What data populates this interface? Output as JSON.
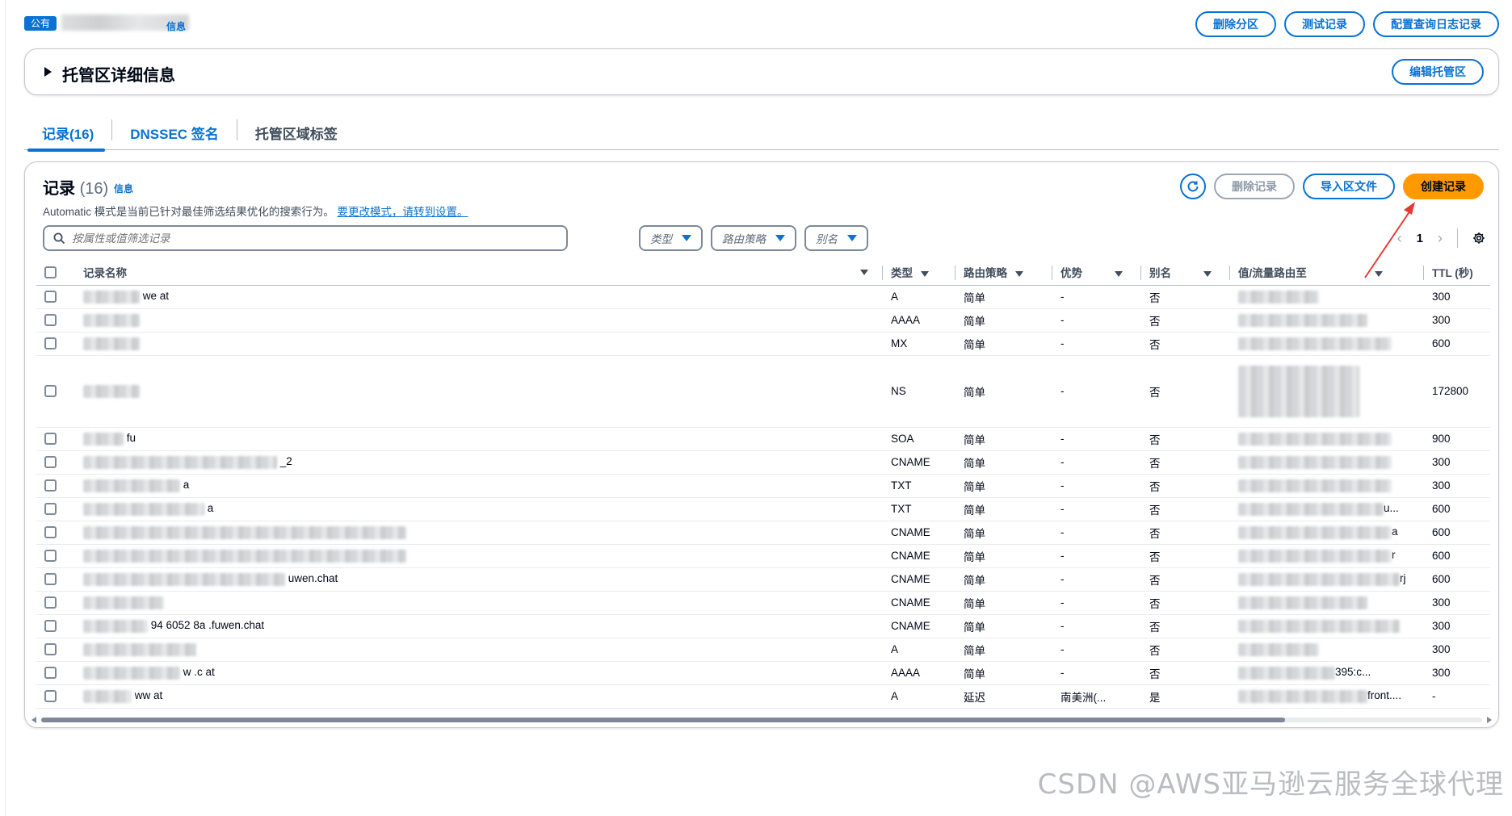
{
  "header": {
    "badge": "公有",
    "info": "信息",
    "actions": [
      {
        "name": "delete-zone-button",
        "label": "删除分区"
      },
      {
        "name": "test-record-button",
        "label": "测试记录"
      },
      {
        "name": "configure-query-logging-button",
        "label": "配置查询日志记录"
      }
    ]
  },
  "details": {
    "title": "托管区详细信息",
    "edit_label": "编辑托管区"
  },
  "tabs": [
    "记录(16)",
    "DNSSEC 签名",
    "托管区域标签"
  ],
  "records": {
    "title": "记录",
    "count": "(16)",
    "info": "信息",
    "mode_text": "Automatic 模式是当前已针对最佳筛选结果优化的搜索行为。",
    "mode_link": "要更改模式，请转到设置。",
    "delete_label": "删除记录",
    "import_label": "导入区文件",
    "create_label": "创建记录",
    "search_placeholder": "按属性或值筛选记录",
    "filters": [
      "类型",
      "路由策略",
      "别名"
    ],
    "page": "1",
    "columns": [
      "记录名称",
      "类型",
      "路由策略",
      "优势",
      "别名",
      "值/流量路由至",
      "TTL (秒)"
    ],
    "rows": [
      {
        "name": "we   at",
        "type": "A",
        "policy": "简单",
        "diff": "-",
        "alias": "否",
        "value": "",
        "ttl": "300"
      },
      {
        "name": "",
        "type": "AAAA",
        "policy": "简单",
        "diff": "-",
        "alias": "否",
        "value": "",
        "ttl": "300"
      },
      {
        "name": "",
        "type": "MX",
        "policy": "简单",
        "diff": "-",
        "alias": "否",
        "value": "",
        "ttl": "600"
      },
      {
        "name": "",
        "type": "NS",
        "policy": "简单",
        "diff": "-",
        "alias": "否",
        "value": "",
        "ttl": "172800"
      },
      {
        "name": "fu",
        "type": "SOA",
        "policy": "简单",
        "diff": "-",
        "alias": "否",
        "value": "",
        "ttl": "900"
      },
      {
        "name": "_2",
        "type": "CNAME",
        "policy": "简单",
        "diff": "-",
        "alias": "否",
        "value": "",
        "ttl": "300"
      },
      {
        "name": "a",
        "type": "TXT",
        "policy": "简单",
        "diff": "-",
        "alias": "否",
        "value": "",
        "ttl": "300"
      },
      {
        "name": "a",
        "type": "TXT",
        "policy": "简单",
        "diff": "-",
        "alias": "否",
        "value": "u...",
        "ttl": "600"
      },
      {
        "name": "",
        "type": "CNAME",
        "policy": "简单",
        "diff": "-",
        "alias": "否",
        "value": "a",
        "ttl": "600"
      },
      {
        "name": "",
        "type": "CNAME",
        "policy": "简单",
        "diff": "-",
        "alias": "否",
        "value": "r",
        "ttl": "600"
      },
      {
        "name": "uwen.chat",
        "type": "CNAME",
        "policy": "简单",
        "diff": "-",
        "alias": "否",
        "value": "rj",
        "ttl": "600"
      },
      {
        "name": "",
        "type": "CNAME",
        "policy": "简单",
        "diff": "-",
        "alias": "否",
        "value": "",
        "ttl": "300"
      },
      {
        "name": "94  6052  8a  .fuwen.chat",
        "type": "CNAME",
        "policy": "简单",
        "diff": "-",
        "alias": "否",
        "value": "",
        "ttl": "300"
      },
      {
        "name": "",
        "type": "A",
        "policy": "简单",
        "diff": "-",
        "alias": "否",
        "value": "",
        "ttl": "300"
      },
      {
        "name": "w   .c  at",
        "type": "AAAA",
        "policy": "简单",
        "diff": "-",
        "alias": "否",
        "value": "395:c...",
        "ttl": "300"
      },
      {
        "name": "ww   at",
        "type": "A",
        "policy": "延迟",
        "diff": "南美洲(...",
        "alias": "是",
        "value": "front....",
        "ttl": "-"
      }
    ]
  },
  "watermark": "CSDN @AWS亚马逊云服务全球代理",
  "colors": {
    "accent": "#0972d3",
    "primary_button": "#ff9900",
    "annotation": "#e53935"
  }
}
